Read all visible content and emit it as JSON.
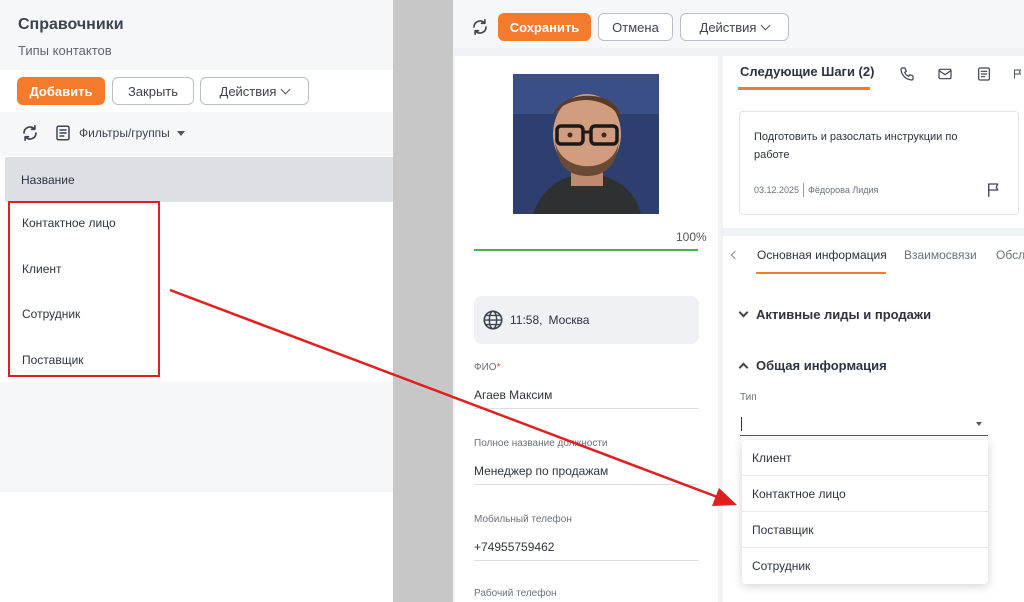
{
  "left_panel": {
    "title": "Справочники",
    "subtitle": "Типы контактов",
    "buttons": {
      "add": "Добавить",
      "close": "Закрыть",
      "actions": "Действия"
    },
    "filters_label": "Фильтры/группы",
    "table": {
      "column_header": "Название",
      "rows": [
        "Контактное лицо",
        "Клиент",
        "Сотрудник",
        "Поставщик"
      ]
    }
  },
  "right_panel": {
    "toolbar": {
      "save": "Сохранить",
      "cancel": "Отмена",
      "actions": "Действия"
    },
    "profile": {
      "progress_text": "100%",
      "progress_value": 1.0,
      "time": "11:58,",
      "city": "Москва",
      "fields": [
        {
          "label": "ФИО",
          "required_mark": "*",
          "value": "Агаев Максим"
        },
        {
          "label": "Полное название должности",
          "value": "Менеджер по продажам"
        },
        {
          "label": "Мобильный телефон",
          "value": "+74955759462"
        },
        {
          "label": "Рабочий телефон",
          "value": ""
        }
      ]
    },
    "next_steps": {
      "title": "Следующие Шаги (2)",
      "task": {
        "text": "Подготовить и разослать инструкции по работе",
        "date": "03.12.2025",
        "assignee": "Фёдорова Лидия"
      }
    },
    "tabs": [
      "Основная информация",
      "Взаимосвязи",
      "Обсл"
    ],
    "sections": {
      "active_leads": "Активные лиды и продажи",
      "general_info": "Общая информация"
    },
    "type_field": {
      "label": "Тип",
      "options": [
        "Клиент",
        "Контактное лицо",
        "Поставщик",
        "Сотрудник"
      ]
    }
  },
  "colors": {
    "accent": "#f47b2e",
    "progress": "#4caf50",
    "annotation": "#e01f1f"
  }
}
